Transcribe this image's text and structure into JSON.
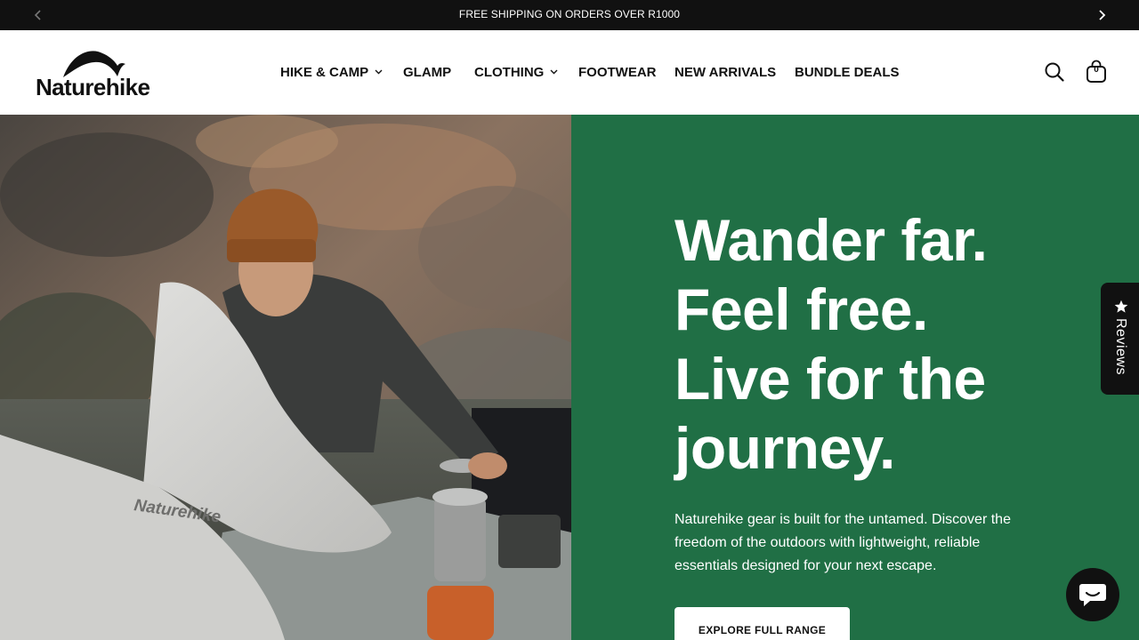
{
  "announcement": {
    "text": "FREE SHIPPING ON ORDERS OVER R1000",
    "prev_icon": "chevron-left-icon",
    "next_icon": "chevron-right-icon"
  },
  "header": {
    "logo_text": "Naturehike",
    "nav": [
      {
        "label": "HIKE & CAMP",
        "has_dropdown": true
      },
      {
        "label": "GLAMP",
        "has_dropdown": false
      },
      {
        "label": "CLOTHING",
        "has_dropdown": true
      },
      {
        "label": "FOOTWEAR",
        "has_dropdown": false
      },
      {
        "label": "NEW ARRIVALS",
        "has_dropdown": false
      },
      {
        "label": "BUNDLE DEALS",
        "has_dropdown": false
      }
    ],
    "search_icon": "search-icon",
    "cart_icon": "shopping-bag-icon",
    "cart_count": "0"
  },
  "hero": {
    "heading_lines": [
      "Wander far.",
      "Feel free.",
      "Live for the",
      "journey."
    ],
    "body": "Naturehike gear is built for the untamed. Discover the freedom of the outdoors with lightweight, reliable essentials designed for your next escape.",
    "cta_label": "EXPLORE FULL RANGE",
    "image_print": "Naturehike",
    "panel_color": "#206f45"
  },
  "reviews_tab": {
    "label": "Reviews",
    "icon": "star-icon"
  },
  "chat": {
    "icon": "chat-icon"
  },
  "colors": {
    "announcement_bg": "#111111",
    "hero_panel": "#206f45",
    "text_dark": "#111111"
  }
}
